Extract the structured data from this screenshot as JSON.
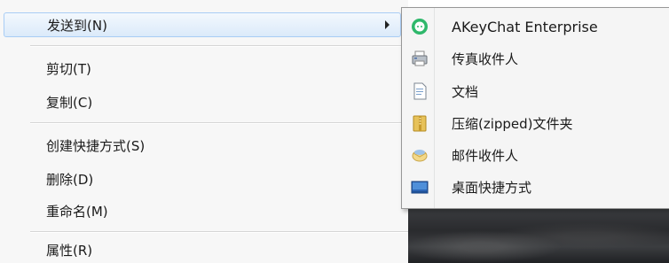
{
  "context_menu": {
    "items": [
      {
        "label": "发送到(N)"
      },
      {
        "label": "剪切(T)"
      },
      {
        "label": "复制(C)"
      },
      {
        "label": "创建快捷方式(S)"
      },
      {
        "label": "删除(D)"
      },
      {
        "label": "重命名(M)"
      },
      {
        "label": "属性(R)"
      }
    ]
  },
  "send_to_submenu": {
    "items": [
      {
        "label": "AKeyChat Enterprise",
        "icon": "akeychat-icon"
      },
      {
        "label": "传真收件人",
        "icon": "fax-icon"
      },
      {
        "label": "文档",
        "icon": "document-icon"
      },
      {
        "label": "压缩(zipped)文件夹",
        "icon": "zip-folder-icon"
      },
      {
        "label": "邮件收件人",
        "icon": "mail-icon"
      },
      {
        "label": "桌面快捷方式",
        "icon": "desktop-icon"
      }
    ]
  },
  "colors": {
    "hover_bg": "#dbeafa",
    "hover_border": "#a9cdf5",
    "akeychat_green": "#2fb86b"
  }
}
